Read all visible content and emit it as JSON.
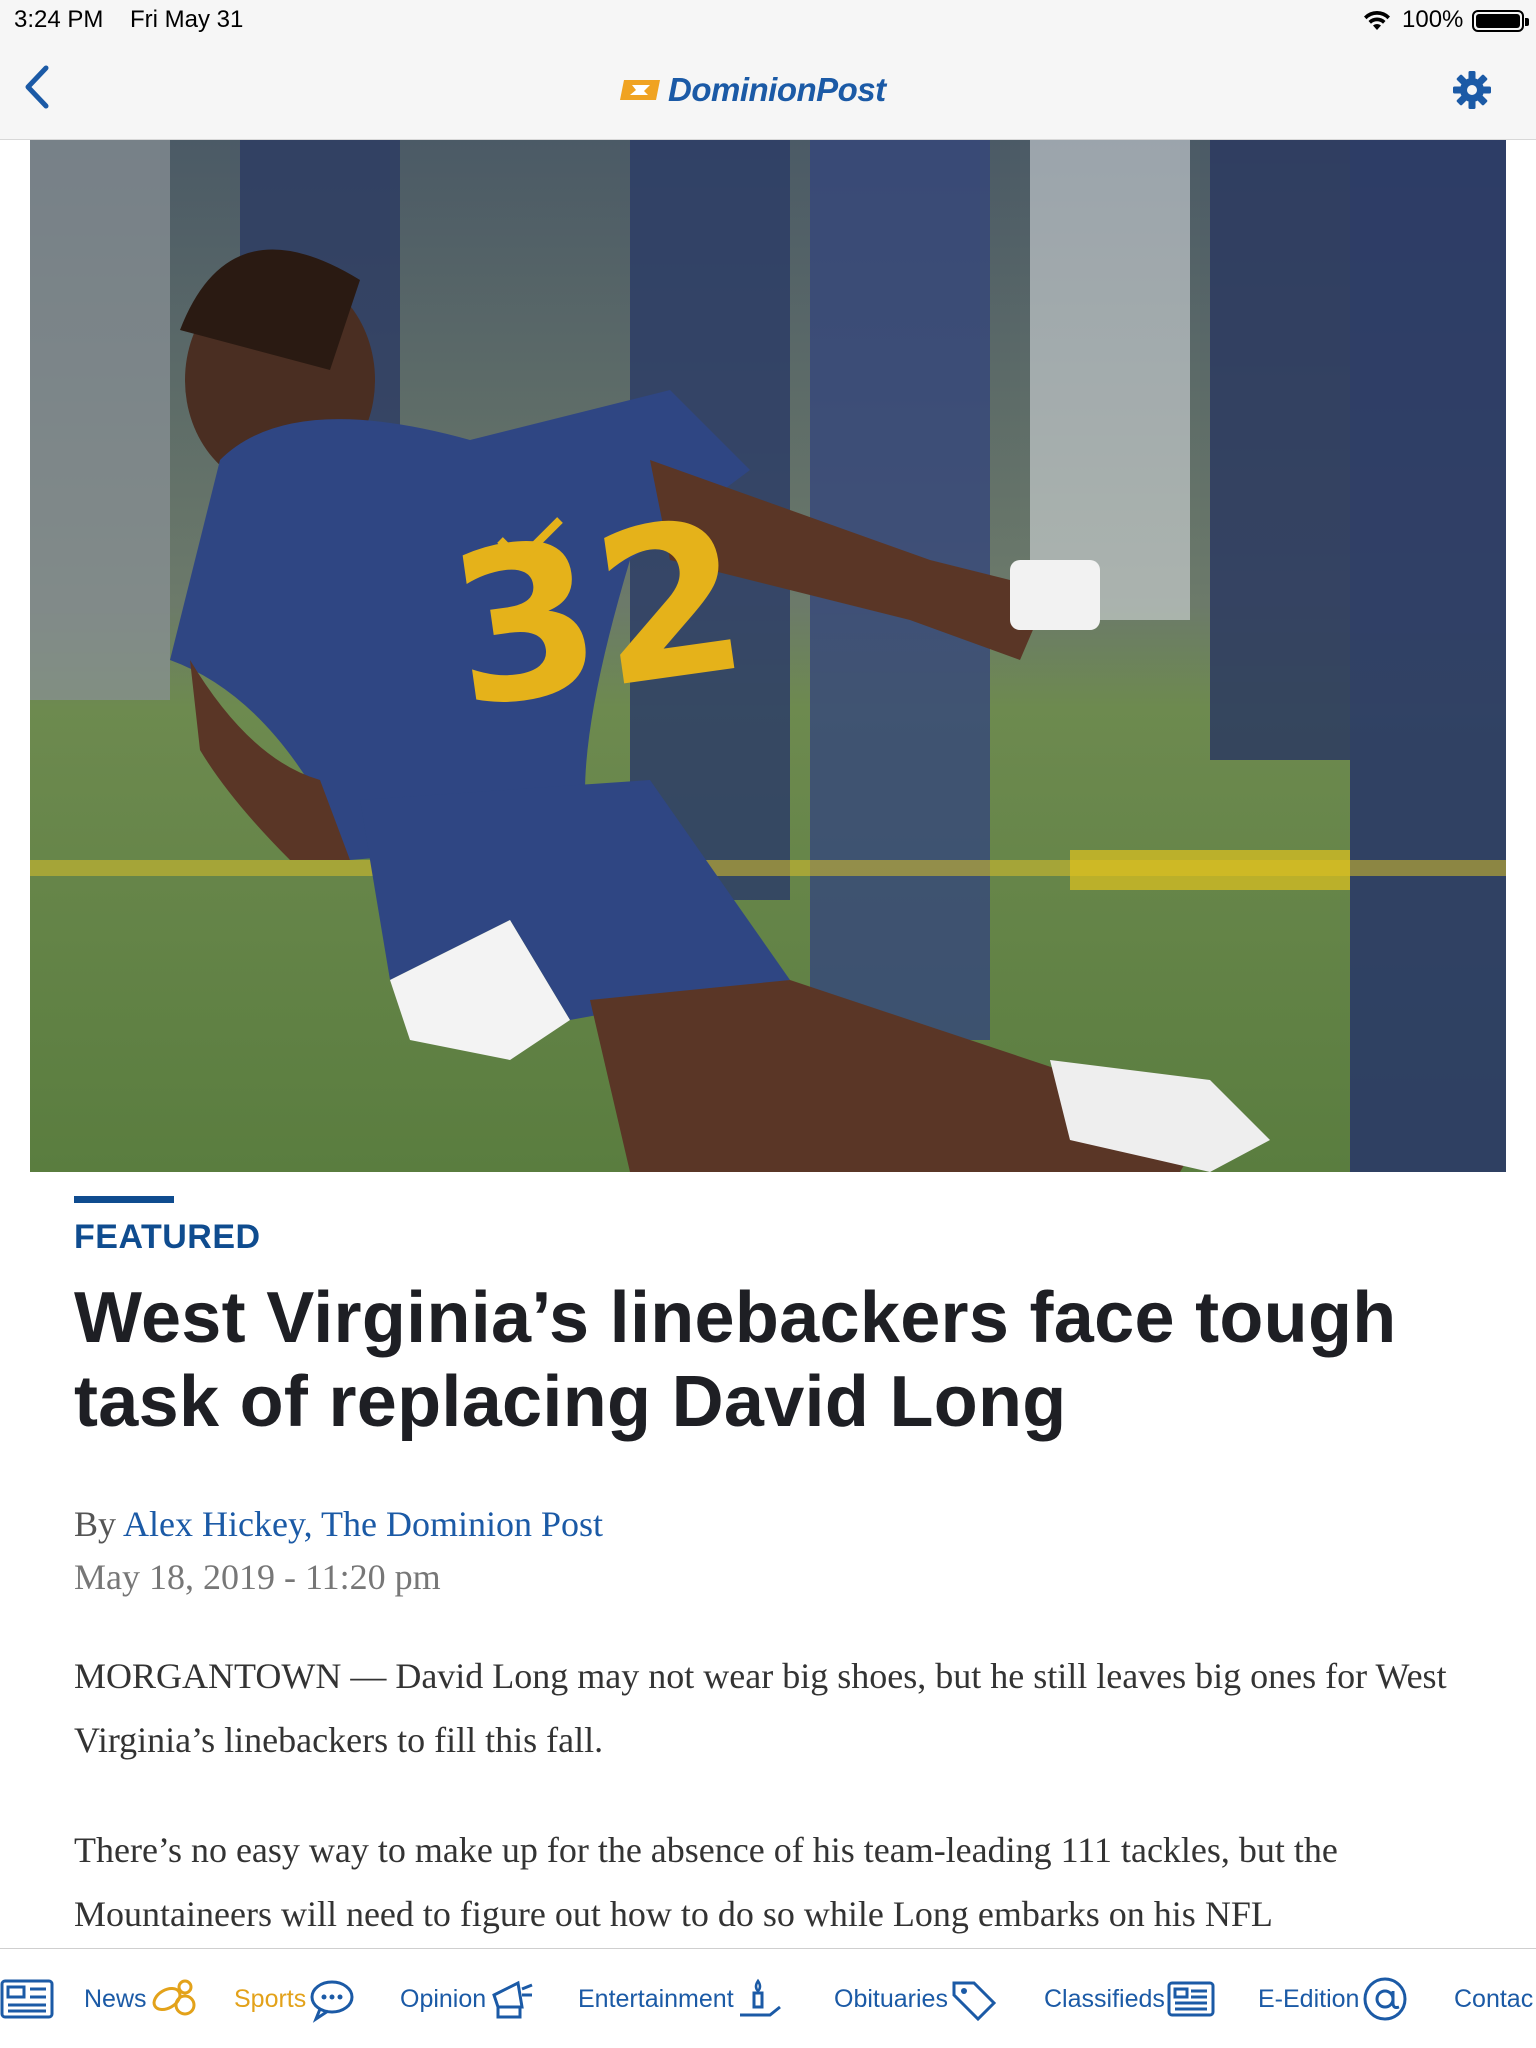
{
  "status_bar": {
    "time": "3:24 PM",
    "date": "Fri May 31",
    "battery": "100%"
  },
  "nav": {
    "logo_text": "DominionPost",
    "brand_color": "#1b5aa6",
    "accent_color": "#e3a21a"
  },
  "hero": {
    "jersey_number": "32"
  },
  "article": {
    "kicker": "FEATURED",
    "headline": "West Virginia’s linebackers face tough task of replacing David Long",
    "byline_prefix": "By ",
    "author": "Alex Hickey, The Dominion Post",
    "date": "May 18, 2019 - 11:20 pm",
    "paragraphs": [
      "MORGANTOWN — David Long may not wear big shoes, but he still leaves big ones for West Virginia’s linebackers to fill this fall.",
      "There’s no easy way to make up for the absence of his team-leading 111 tackles, but the Mountaineers will need to figure out how to do so while Long embarks on his NFL"
    ]
  },
  "tabs": [
    {
      "label": "News",
      "icon": "football-icon",
      "active": false
    },
    {
      "label": "Sports",
      "icon": "chat-bubble-icon",
      "active": true
    },
    {
      "label": "Opinion",
      "icon": "megaphone-icon",
      "active": false
    },
    {
      "label": "Entertainment",
      "icon": "candle-hand-icon",
      "active": false
    },
    {
      "label": "Obituaries",
      "icon": "tag-icon",
      "active": false
    },
    {
      "label": "Classifieds",
      "icon": "newspaper-icon",
      "active": false
    },
    {
      "label": "E-Edition",
      "icon": "at-sign-icon",
      "active": false
    },
    {
      "label": "Contac",
      "icon": "",
      "active": false
    }
  ]
}
